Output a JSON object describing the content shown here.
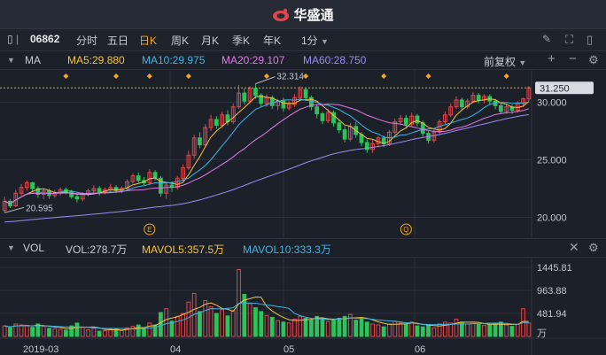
{
  "app": {
    "title": "华盛通"
  },
  "toolbar": {
    "code": "06862",
    "periods": [
      "分时",
      "五日",
      "日K",
      "周K",
      "月K",
      "季K",
      "年K"
    ],
    "active_period": "日K",
    "minute_select": "1分"
  },
  "ma": {
    "label": "MA",
    "ma5": "MA5:29.880",
    "ma10": "MA10:29.975",
    "ma20": "MA20:29.107",
    "ma60": "MA60:28.750",
    "adjust": "前复权",
    "colors": {
      "ma5": "#f5c342",
      "ma10": "#3fb5e5",
      "ma20": "#e07be6",
      "ma60": "#9c8cf2",
      "up": "#e0474c",
      "down": "#2bc459",
      "current": "#f5a623"
    }
  },
  "price_axis": {
    "current": "31.250",
    "ticks": [
      "30.000",
      "25.000",
      "20.000"
    ]
  },
  "annotations": {
    "high": "32.314",
    "low": "20.595",
    "marker_e": "E",
    "marker_q": "Q"
  },
  "vol": {
    "label": "VOL",
    "vol": "VOL:278.7万",
    "mavol5": "MAVOL5:357.5万",
    "mavol10": "MAVOL10:333.3万",
    "ticks": [
      "1445.81",
      "963.88",
      "481.94"
    ],
    "unit": "万"
  },
  "time_axis": [
    "2019-03",
    "04",
    "05",
    "06"
  ],
  "chart_data": {
    "type": "candlestick",
    "ylim": [
      18.5,
      32.5
    ],
    "vol_max": 1445.81,
    "candles": [
      [
        20.6,
        21.4,
        21.8,
        20.4,
        220
      ],
      [
        21.4,
        21.0,
        21.6,
        20.8,
        180
      ],
      [
        21.0,
        22.1,
        22.4,
        20.9,
        260
      ],
      [
        22.1,
        22.6,
        22.9,
        21.9,
        240
      ],
      [
        22.6,
        23.0,
        23.2,
        22.3,
        230
      ],
      [
        23.0,
        22.5,
        23.1,
        22.2,
        190
      ],
      [
        22.5,
        22.0,
        22.7,
        21.7,
        260
      ],
      [
        22.0,
        22.3,
        22.5,
        21.6,
        210
      ],
      [
        22.3,
        21.9,
        22.5,
        21.6,
        170
      ],
      [
        21.9,
        22.1,
        22.4,
        21.7,
        160
      ],
      [
        22.1,
        22.4,
        22.6,
        21.9,
        150
      ],
      [
        22.4,
        22.2,
        22.6,
        22.0,
        130
      ],
      [
        22.2,
        21.8,
        22.4,
        21.6,
        220
      ],
      [
        21.8,
        21.6,
        22.0,
        21.3,
        280
      ],
      [
        21.6,
        22.0,
        22.2,
        21.4,
        190
      ],
      [
        22.0,
        22.3,
        22.5,
        21.8,
        140
      ],
      [
        22.3,
        22.5,
        22.8,
        22.1,
        170
      ],
      [
        22.5,
        22.2,
        22.7,
        21.9,
        110
      ],
      [
        22.2,
        22.4,
        22.6,
        22.0,
        120
      ],
      [
        22.4,
        22.6,
        22.9,
        22.2,
        150
      ],
      [
        22.6,
        22.3,
        22.8,
        22.1,
        160
      ],
      [
        22.3,
        22.5,
        22.7,
        22.1,
        120
      ],
      [
        22.5,
        23.1,
        23.3,
        22.3,
        180
      ],
      [
        23.1,
        23.6,
        23.8,
        22.9,
        210
      ],
      [
        23.6,
        23.2,
        23.9,
        23.0,
        240
      ],
      [
        23.2,
        23.0,
        23.5,
        22.8,
        170
      ],
      [
        23.0,
        23.9,
        24.2,
        22.8,
        280
      ],
      [
        23.9,
        23.4,
        24.1,
        23.2,
        240
      ],
      [
        23.4,
        22.1,
        23.6,
        21.8,
        500
      ],
      [
        22.1,
        22.8,
        23.0,
        21.6,
        580
      ],
      [
        22.8,
        22.6,
        23.1,
        22.2,
        320
      ],
      [
        22.6,
        23.4,
        23.6,
        22.4,
        420
      ],
      [
        23.4,
        24.3,
        24.6,
        23.2,
        480
      ],
      [
        24.3,
        25.4,
        25.8,
        24.1,
        720
      ],
      [
        25.4,
        26.9,
        27.2,
        25.1,
        900
      ],
      [
        26.9,
        26.3,
        27.4,
        26.0,
        520
      ],
      [
        26.3,
        27.8,
        28.1,
        26.1,
        750
      ],
      [
        27.8,
        28.5,
        28.9,
        27.5,
        620
      ],
      [
        28.5,
        28.0,
        28.8,
        27.7,
        480
      ],
      [
        28.0,
        28.9,
        29.2,
        27.8,
        560
      ],
      [
        28.9,
        28.3,
        29.3,
        28.0,
        430
      ],
      [
        28.3,
        29.6,
        29.9,
        28.1,
        540
      ],
      [
        29.6,
        30.8,
        31.5,
        29.4,
        1400
      ],
      [
        30.8,
        30.1,
        31.2,
        29.8,
        880
      ],
      [
        30.1,
        31.2,
        31.4,
        29.9,
        700
      ],
      [
        31.2,
        30.6,
        31.6,
        30.3,
        600
      ],
      [
        30.6,
        29.9,
        30.8,
        29.6,
        520
      ],
      [
        29.9,
        30.4,
        30.7,
        29.6,
        440
      ],
      [
        30.4,
        29.7,
        30.6,
        29.4,
        400
      ],
      [
        29.7,
        30.1,
        30.3,
        29.3,
        330
      ],
      [
        30.1,
        29.5,
        30.4,
        29.2,
        300
      ],
      [
        29.5,
        29.8,
        30.1,
        29.3,
        280
      ],
      [
        29.8,
        30.4,
        30.7,
        29.6,
        360
      ],
      [
        30.4,
        31.1,
        31.4,
        30.1,
        420
      ],
      [
        31.1,
        30.4,
        31.3,
        30.1,
        380
      ],
      [
        30.4,
        29.6,
        30.6,
        29.3,
        350
      ],
      [
        29.6,
        29.0,
        29.8,
        28.6,
        420
      ],
      [
        29.0,
        28.4,
        29.2,
        28.1,
        380
      ],
      [
        28.4,
        29.1,
        29.4,
        28.2,
        310
      ],
      [
        29.1,
        28.2,
        29.3,
        27.9,
        350
      ],
      [
        28.2,
        27.6,
        28.5,
        27.3,
        380
      ],
      [
        27.6,
        26.8,
        27.9,
        26.5,
        420
      ],
      [
        26.8,
        27.9,
        28.2,
        26.6,
        460
      ],
      [
        27.9,
        27.2,
        28.3,
        26.9,
        340
      ],
      [
        27.2,
        26.5,
        27.4,
        26.2,
        380
      ],
      [
        26.5,
        25.9,
        26.8,
        25.6,
        300
      ],
      [
        25.9,
        26.4,
        26.7,
        25.6,
        260
      ],
      [
        26.4,
        26.9,
        27.1,
        26.1,
        240
      ],
      [
        26.9,
        26.4,
        27.1,
        26.1,
        200
      ],
      [
        26.4,
        27.4,
        27.6,
        26.2,
        260
      ],
      [
        27.4,
        28.3,
        28.6,
        27.2,
        320
      ],
      [
        28.3,
        28.6,
        28.9,
        28.0,
        280
      ],
      [
        28.6,
        28.1,
        28.9,
        27.8,
        260
      ],
      [
        28.1,
        28.8,
        29.1,
        27.9,
        300
      ],
      [
        28.8,
        28.2,
        29.0,
        27.9,
        220
      ],
      [
        28.2,
        27.3,
        28.4,
        27.0,
        200
      ],
      [
        27.3,
        26.7,
        27.5,
        26.4,
        230
      ],
      [
        26.7,
        27.4,
        27.6,
        26.5,
        180
      ],
      [
        27.4,
        28.3,
        28.5,
        27.2,
        260
      ],
      [
        28.3,
        28.9,
        29.2,
        28.1,
        300
      ],
      [
        28.9,
        29.6,
        29.9,
        28.7,
        280
      ],
      [
        29.6,
        30.2,
        30.5,
        29.4,
        360
      ],
      [
        30.2,
        29.6,
        30.4,
        29.3,
        300
      ],
      [
        29.6,
        30.1,
        30.3,
        29.4,
        260
      ],
      [
        30.1,
        30.6,
        30.9,
        29.9,
        300
      ],
      [
        30.6,
        30.2,
        30.8,
        29.9,
        250
      ],
      [
        30.2,
        30.5,
        30.7,
        29.9,
        230
      ],
      [
        30.5,
        30.1,
        30.7,
        29.8,
        240
      ],
      [
        30.1,
        29.7,
        30.3,
        29.4,
        260
      ],
      [
        29.7,
        29.2,
        29.9,
        29.0,
        300
      ],
      [
        29.2,
        29.6,
        29.8,
        29.0,
        240
      ],
      [
        29.6,
        29.3,
        29.8,
        29.0,
        210
      ],
      [
        29.3,
        29.9,
        30.1,
        29.1,
        250
      ],
      [
        29.9,
        30.3,
        30.4,
        29.6,
        580
      ],
      [
        30.3,
        31.25,
        31.4,
        30.1,
        278.7
      ]
    ]
  }
}
